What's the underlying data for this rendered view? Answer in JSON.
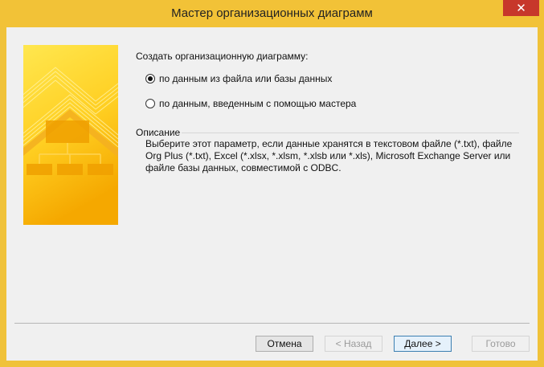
{
  "window": {
    "title": "Мастер организационных диаграмм",
    "close_glyph": "✕"
  },
  "wizard": {
    "prompt": "Создать организационную диаграмму:",
    "options": [
      {
        "label": "по данным из файла или базы данных",
        "selected": true
      },
      {
        "label": "по данным, введенным с помощью мастера",
        "selected": false
      }
    ],
    "description": {
      "title": "Описание",
      "text": "Выберите этот параметр, если данные хранятся в текстовом файле (*.txt), файле Org Plus (*.txt), Excel (*.xlsx, *.xlsm, *.xlsb или *.xls), Microsoft Exchange Server или файле базы данных, совместимой с ODBC."
    }
  },
  "buttons": {
    "cancel": "Отмена",
    "back": "< Назад",
    "next": "Далее >",
    "finish": "Готово"
  },
  "colors": {
    "accent": "#f2c237",
    "close": "#c7372b",
    "banner_light": "#ffe34d",
    "banner_dark": "#f2a000"
  }
}
